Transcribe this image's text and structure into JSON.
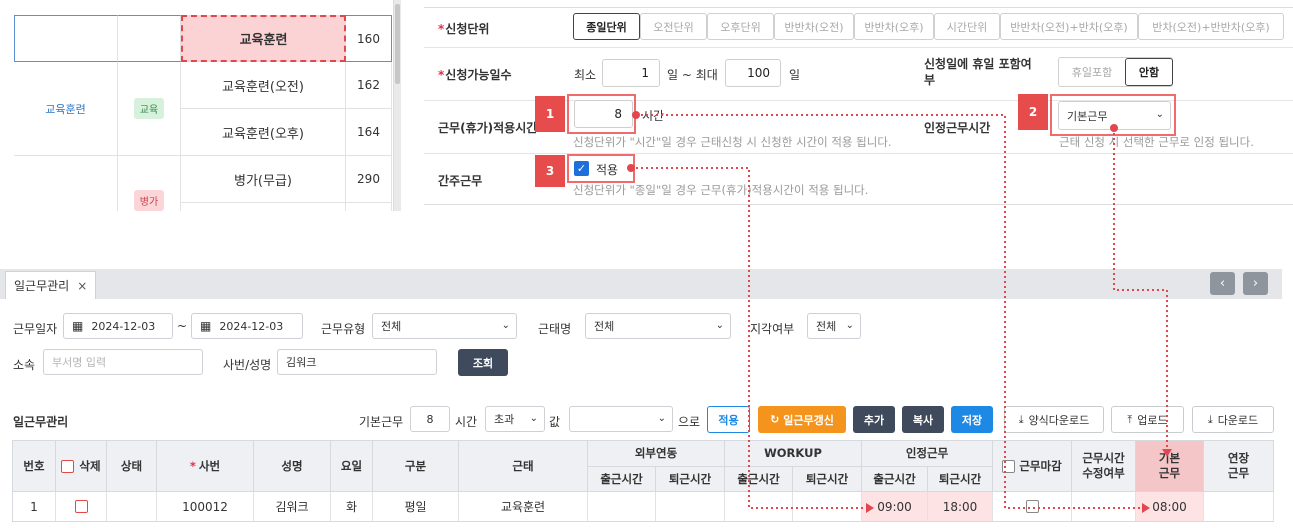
{
  "top_table": {
    "rows": [
      {
        "category": "",
        "tag": "",
        "name": "교육훈련",
        "code": "160",
        "selected": true
      },
      {
        "category": "교육훈련",
        "tag": "교육",
        "name": "교육훈련(오전)",
        "code": "162"
      },
      {
        "category": "",
        "tag": "",
        "name": "교육훈련(오후)",
        "code": "164"
      },
      {
        "category": "",
        "tag": "병가",
        "name": "병가(무급)",
        "code": "290"
      }
    ]
  },
  "form": {
    "unit_label": "신청단위",
    "unit_options": [
      "종일단위",
      "오전단위",
      "오후단위",
      "반반차(오전)",
      "반반차(오후)",
      "시간단위",
      "반반차(오전)+반차(오후)",
      "반차(오전)+반반차(오후)"
    ],
    "unit_selected": "종일단위",
    "days_label": "신청가능일수",
    "min_label": "최소",
    "min_value": "1",
    "sep_label": "일 ~ 최대",
    "max_value": "100",
    "day_unit": "일",
    "holiday_label": "신청일에 휴일 포함여부",
    "holiday_options": [
      "휴일포함",
      "안함"
    ],
    "holiday_selected": "안함",
    "work_hours_label": "근무(휴가)적용시간",
    "work_hours_value": "8",
    "work_hours_unit": "시간",
    "work_hours_hint": "신청단위가 \"시간\"일 경우 근태신청 시 신청한 시간이 적용 됩니다.",
    "recognized_label": "인정근무시간",
    "recognized_value": "기본근무",
    "recognized_hint": "근태 신청 시 선택한 근무로 인정 됩니다.",
    "deemed_label": "간주근무",
    "deemed_check_label": "적용",
    "deemed_hint": "신청단위가 \"종일\"일 경우 근무(휴가)적용시간이 적용 됩니다.",
    "badges": [
      "1",
      "2",
      "3"
    ]
  },
  "panel": {
    "tab_label": "일근무관리",
    "tab_close": "×",
    "nav_prev": "‹",
    "nav_next": "›",
    "date_label": "근무일자",
    "date_from": "2024-12-03",
    "date_sep": "~",
    "date_to": "2024-12-03",
    "type_label": "근무유형",
    "type_value": "전체",
    "attend_label": "근태명",
    "attend_value": "전체",
    "late_label": "지각여부",
    "late_value": "전체",
    "dept_label": "소속",
    "dept_placeholder": "부서명 입력",
    "emp_label": "사번/성명",
    "emp_value": "김워크",
    "search_btn": "조회",
    "section_title": "일근무관리",
    "base_label": "기본근무",
    "base_value": "8",
    "hour_label": "시간",
    "cond_value": "초과",
    "value_label": "값",
    "target_value": "",
    "to_label": "으로",
    "apply_btn": "적용",
    "refresh_btn": "일근무갱신",
    "add_btn": "추가",
    "copy_btn": "복사",
    "save_btn": "저장",
    "template_btn": "양식다운로드",
    "upload_btn": "업로드",
    "download_btn": "다운로드"
  },
  "grid": {
    "headers": {
      "no": "번호",
      "del": "삭제",
      "status": "상태",
      "emp_no": "사번",
      "name": "성명",
      "weekday": "요일",
      "kind": "구분",
      "attend": "근태",
      "external": "외부연동",
      "workup": "WORKUP",
      "recognized": "인정근무",
      "in": "출근시간",
      "out": "퇴근시간",
      "close": "근무마감",
      "modified": "근무시간 수정여부",
      "base": "기본 근무",
      "extend": "연장 근무"
    },
    "rows": [
      {
        "no": "1",
        "status": "",
        "emp_no": "100012",
        "name": "김워크",
        "weekday": "화",
        "kind": "평일",
        "attend": "교육훈련",
        "ext_in": "",
        "ext_out": "",
        "wu_in": "",
        "wu_out": "",
        "rec_in": "09:00",
        "rec_out": "18:00",
        "modified": "",
        "base": "08:00",
        "extend": ""
      }
    ]
  },
  "colors": {
    "accent_red": "#e74c4c",
    "dark_button": "#3f4a5c",
    "orange_button": "#f5941d",
    "blue_button": "#1e88e5",
    "pink_header": "#f5c6c8"
  }
}
